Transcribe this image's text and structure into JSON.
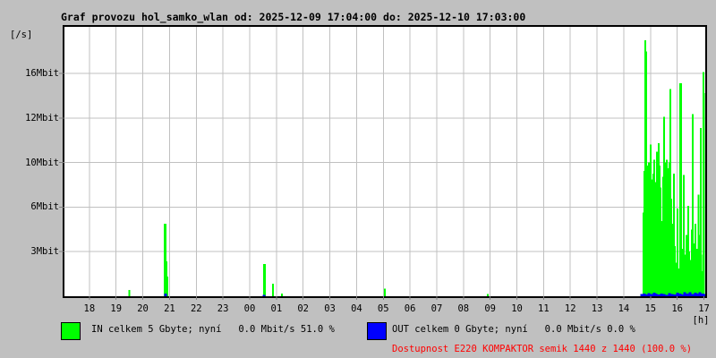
{
  "title": "Graf provozu hol_samko_wlan od: 2025-12-09 17:04:00 do: 2025-12-10 17:03:00",
  "colors": {
    "background": "#c0c0c0",
    "plot_background": "#ffffff",
    "grid": "#c0c0c0",
    "tick": "#808080",
    "axis_border": "#000000",
    "in": "#00ff00",
    "out": "#0000ff",
    "availability": "#ff0000",
    "text": "#000000"
  },
  "y_axis": {
    "unit_label": "[/s]",
    "ticks": [
      {
        "label": "16Mbit",
        "value": 16.0
      },
      {
        "label": "12Mbit",
        "value": 12.8
      },
      {
        "label": "10Mbit",
        "value": 9.6
      },
      {
        "label": "6Mbit",
        "value": 6.4
      },
      {
        "label": "3Mbit",
        "value": 3.2
      }
    ]
  },
  "x_axis": {
    "unit_label": "[h]",
    "labels": [
      "18",
      "19",
      "20",
      "21",
      "22",
      "23",
      "00",
      "01",
      "02",
      "03",
      "04",
      "05",
      "06",
      "07",
      "08",
      "09",
      "10",
      "11",
      "12",
      "13",
      "14",
      "15",
      "16",
      "17"
    ],
    "first_tick_offset_hours": 0.9333,
    "hours_span": 23.983
  },
  "legend": {
    "in": {
      "swatch_color": "#00ff00",
      "label": "IN celkem 5 Gbyte; nyní   0.0 Mbit/s 51.0 %"
    },
    "out": {
      "swatch_color": "#0000ff",
      "label": "OUT celkem 0 Gbyte; nyní   0.0 Mbit/s 0.0 %"
    }
  },
  "availability": {
    "text": "Dostupnost E220 KOMPAKTOR semik 1440 z 1440 (100.0 %)",
    "color": "#ff0000"
  },
  "chart_data": {
    "type": "line",
    "title": "Graf provozu hol_samko_wlan od: 2025-12-09 17:04:00 do: 2025-12-10 17:03:00",
    "xlabel": "[h]",
    "ylabel": "[/s]",
    "x_unit": "hours_since_start",
    "y_unit": "Mbit/s",
    "xlim": [
      0,
      23.983
    ],
    "ylim": [
      0,
      19.36
    ],
    "grid": true,
    "series": [
      {
        "name": "IN",
        "color": "#00ff00",
        "points": [
          [
            2.43,
            0.45
          ],
          [
            3.75,
            5.2
          ],
          [
            3.79,
            5.2
          ],
          [
            3.82,
            2.5
          ],
          [
            3.85,
            1.4
          ],
          [
            7.47,
            2.3
          ],
          [
            7.5,
            2.3
          ],
          [
            7.8,
            0.9
          ],
          [
            8.14,
            0.2
          ],
          [
            11.99,
            0.55
          ],
          [
            15.85,
            0.15
          ],
          [
            21.68,
            6.0
          ],
          [
            21.71,
            9.0
          ],
          [
            21.74,
            18.4
          ],
          [
            21.78,
            17.6
          ],
          [
            21.81,
            9.4
          ],
          [
            21.84,
            8.6
          ],
          [
            21.88,
            9.6
          ],
          [
            21.91,
            8.8
          ],
          [
            21.94,
            10.9
          ],
          [
            21.98,
            8.4
          ],
          [
            22.01,
            7.6
          ],
          [
            22.04,
            8.8
          ],
          [
            22.08,
            9.8
          ],
          [
            22.11,
            8.2
          ],
          [
            22.14,
            7.2
          ],
          [
            22.18,
            10.4
          ],
          [
            22.21,
            9.0
          ],
          [
            22.24,
            11.0
          ],
          [
            22.28,
            9.4
          ],
          [
            22.31,
            7.8
          ],
          [
            22.34,
            5.4
          ],
          [
            22.38,
            4.8
          ],
          [
            22.41,
            8.6
          ],
          [
            22.44,
            12.9
          ],
          [
            22.48,
            9.6
          ],
          [
            22.51,
            8.8
          ],
          [
            22.54,
            9.8
          ],
          [
            22.58,
            8.4
          ],
          [
            22.61,
            9.2
          ],
          [
            22.64,
            9.6
          ],
          [
            22.68,
            14.9
          ],
          [
            22.71,
            7.0
          ],
          [
            22.74,
            5.2
          ],
          [
            22.78,
            4.0
          ],
          [
            22.81,
            8.8
          ],
          [
            22.84,
            3.6
          ],
          [
            22.88,
            2.4
          ],
          [
            22.91,
            1.6
          ],
          [
            22.94,
            6.3
          ],
          [
            22.98,
            2.0
          ],
          [
            23.01,
            1.2
          ],
          [
            23.04,
            15.3
          ],
          [
            23.08,
            15.3
          ],
          [
            23.11,
            3.4
          ],
          [
            23.14,
            1.8
          ],
          [
            23.18,
            8.7
          ],
          [
            23.21,
            3.0
          ],
          [
            23.24,
            1.4
          ],
          [
            23.28,
            4.4
          ],
          [
            23.31,
            2.6
          ],
          [
            23.34,
            6.5
          ],
          [
            23.38,
            3.2
          ],
          [
            23.41,
            1.8
          ],
          [
            23.44,
            2.6
          ],
          [
            23.48,
            4.8
          ],
          [
            23.51,
            13.1
          ],
          [
            23.54,
            3.8
          ],
          [
            23.58,
            2.0
          ],
          [
            23.61,
            5.2
          ],
          [
            23.64,
            1.4
          ],
          [
            23.68,
            3.4
          ],
          [
            23.71,
            2.2
          ],
          [
            23.74,
            7.3
          ],
          [
            23.78,
            4.4
          ],
          [
            23.81,
            12.1
          ],
          [
            23.84,
            3.0
          ],
          [
            23.88,
            1.8
          ],
          [
            23.91,
            16.1
          ],
          [
            23.94,
            14.6
          ]
        ]
      },
      {
        "name": "OUT",
        "color": "#0000ff",
        "points": [
          [
            3.79,
            0.18
          ],
          [
            7.47,
            0.1
          ],
          [
            21.61,
            0.15
          ],
          [
            21.71,
            0.2
          ],
          [
            21.78,
            0.12
          ],
          [
            21.88,
            0.22
          ],
          [
            21.98,
            0.15
          ],
          [
            22.08,
            0.25
          ],
          [
            22.14,
            0.18
          ],
          [
            22.24,
            0.12
          ],
          [
            22.34,
            0.2
          ],
          [
            22.44,
            0.15
          ],
          [
            22.54,
            0.1
          ],
          [
            22.64,
            0.22
          ],
          [
            22.74,
            0.15
          ],
          [
            22.84,
            0.12
          ],
          [
            22.94,
            0.25
          ],
          [
            23.04,
            0.18
          ],
          [
            23.11,
            0.12
          ],
          [
            23.21,
            0.3
          ],
          [
            23.31,
            0.2
          ],
          [
            23.41,
            0.28
          ],
          [
            23.51,
            0.15
          ],
          [
            23.61,
            0.25
          ],
          [
            23.68,
            0.18
          ],
          [
            23.78,
            0.3
          ],
          [
            23.88,
            0.2
          ],
          [
            23.94,
            0.15
          ]
        ]
      }
    ]
  }
}
